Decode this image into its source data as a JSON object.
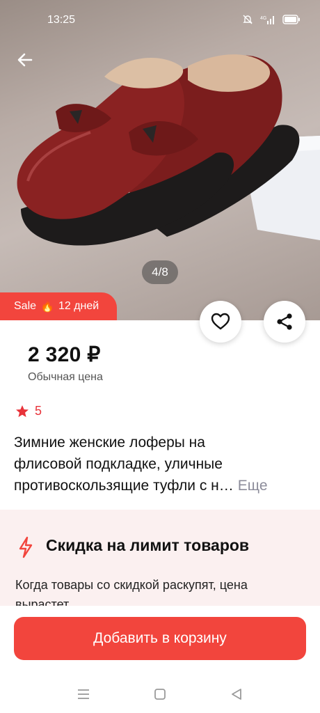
{
  "status_bar": {
    "time": "13:25",
    "network": "4G"
  },
  "gallery": {
    "current": 4,
    "total": 8,
    "indicator": "4/8"
  },
  "sale_badge": {
    "label": "Sale",
    "emoji": "🔥",
    "days": "12 дней"
  },
  "price": {
    "value": "2 320 ₽",
    "caption": "Обычная цена"
  },
  "rating": {
    "value": "5"
  },
  "title": {
    "lines": [
      "Зимние женские лоферы на",
      "флисовой подкладке, уличные",
      "противоскользящие туфли с н…"
    ],
    "more": "Еще"
  },
  "discount": {
    "title": "Скидка на лимит товаров",
    "text": "Когда товары со скидкой раскупят, цена вырастет"
  },
  "cart_button": {
    "label": "Добавить в корзину"
  },
  "icons": {
    "back": "arrow-left-icon",
    "favorite": "heart-icon",
    "share": "share-icon",
    "rating": "star-icon",
    "discount": "lightning-icon",
    "nav": [
      "menu-icon",
      "home-square-icon",
      "back-triangle-icon"
    ]
  },
  "colors": {
    "accent": "#f2453d",
    "rating": "#e8333a",
    "discount_bg": "#fbf0f0",
    "muted": "#8c8c9a"
  }
}
